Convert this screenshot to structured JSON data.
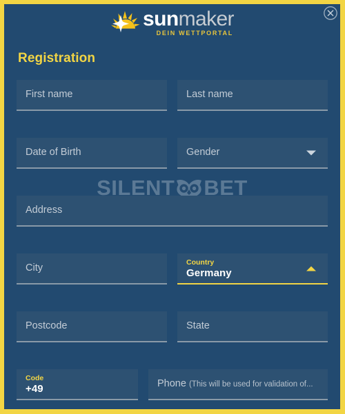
{
  "window": {
    "close_icon": "close-circle-icon",
    "border_color": "#f2d544",
    "background_color": "#224a70",
    "field_background_color": "#2d5172",
    "accent_color": "#f2d544"
  },
  "logo": {
    "icon": "sunburst-icon",
    "word_bold": "sun",
    "word_light": "maker",
    "tagline": "DEIN WETTPORTAL"
  },
  "page_title": "Registration",
  "watermark": {
    "text_left": "SILENT",
    "icon": "owl-icon",
    "text_right": "BET"
  },
  "form": {
    "fields": {
      "first_name": {
        "placeholder": "First name",
        "value": ""
      },
      "last_name": {
        "placeholder": "Last name",
        "value": ""
      },
      "date_of_birth": {
        "placeholder": "Date of Birth",
        "value": ""
      },
      "gender": {
        "placeholder": "Gender",
        "value": "",
        "arrow": "chevron-down-icon"
      },
      "address": {
        "placeholder": "Address",
        "value": ""
      },
      "city": {
        "placeholder": "City",
        "value": ""
      },
      "country": {
        "label": "Country",
        "value": "Germany",
        "arrow": "chevron-up-icon",
        "state": "active"
      },
      "postcode": {
        "placeholder": "Postcode",
        "value": ""
      },
      "state": {
        "placeholder": "State",
        "value": ""
      },
      "code": {
        "label": "Code",
        "value": "+49"
      },
      "phone": {
        "placeholder_main": "Phone",
        "placeholder_sub": "(This will be used for validation of...",
        "value": ""
      }
    }
  }
}
